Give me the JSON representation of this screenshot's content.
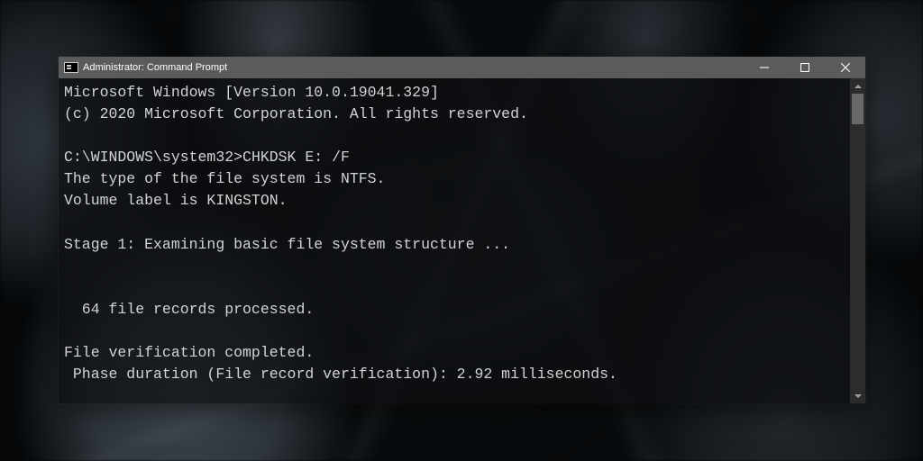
{
  "window": {
    "title": "Administrator: Command Prompt",
    "controls": {
      "minimize": "minimize",
      "maximize": "maximize",
      "close": "close"
    }
  },
  "terminal": {
    "banner_line1": "Microsoft Windows [Version 10.0.19041.329]",
    "banner_line2": "(c) 2020 Microsoft Corporation. All rights reserved.",
    "prompt_path": "C:\\WINDOWS\\system32>",
    "command": "CHKDSK E: /F",
    "fs_type_line": "The type of the file system is NTFS.",
    "volume_label_line": "Volume label is KINGSTON.",
    "stage_line": "Stage 1: Examining basic file system structure ...",
    "records_line": "  64 file records processed.",
    "verification_line": "File verification completed.",
    "phase_line": " Phase duration (File record verification): 2.92 milliseconds."
  }
}
